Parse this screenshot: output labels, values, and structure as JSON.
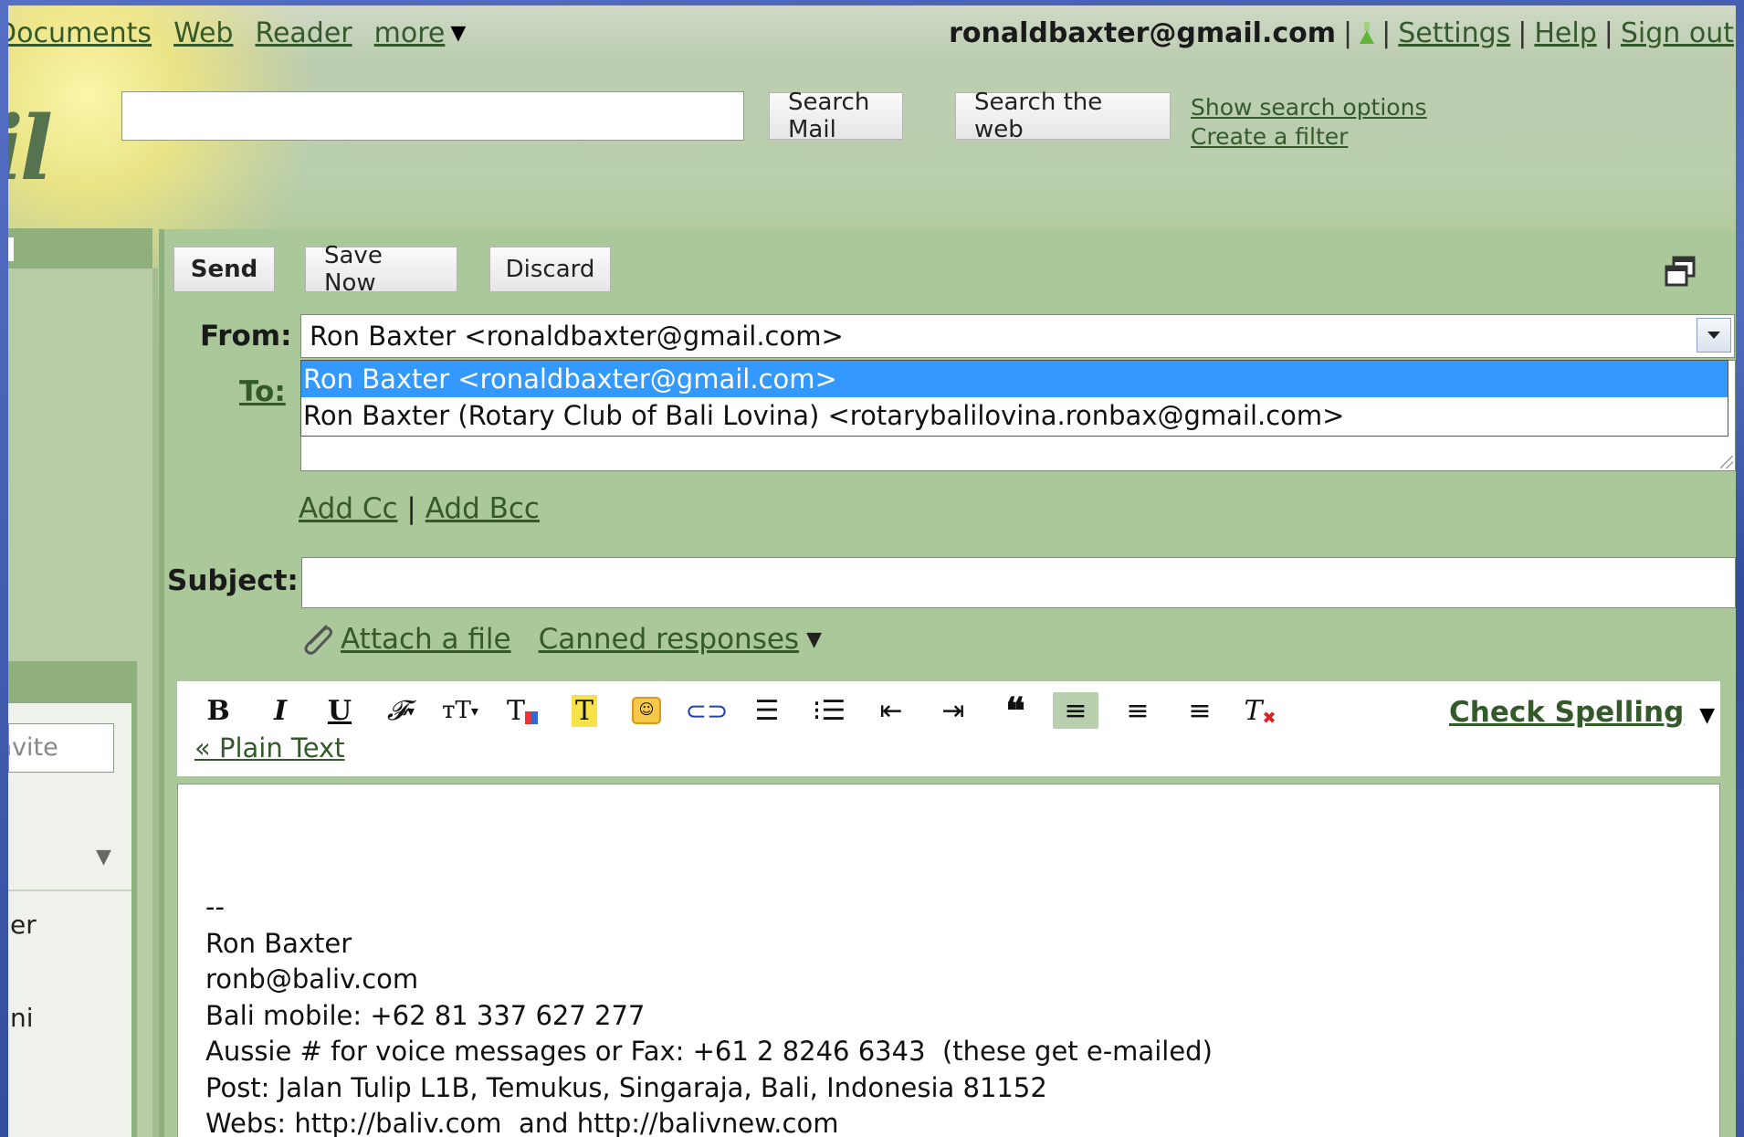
{
  "topnav": {
    "links": [
      "Documents",
      "Web",
      "Reader",
      "more"
    ],
    "more_arrow": "▼"
  },
  "usernav": {
    "email": "ronaldbaxter@gmail.com",
    "settings": "Settings",
    "help": "Help",
    "signout": "Sign out"
  },
  "logo_text": "ail",
  "search": {
    "query": "",
    "search_mail_label": "Search Mail",
    "search_web_label": "Search the web",
    "show_options": "Show search options",
    "create_filter": "Create a filter"
  },
  "sidebar": {
    "invite_placeholder": "Invite",
    "items": [
      "er",
      "ni"
    ]
  },
  "compose": {
    "send_label": "Send",
    "save_label": "Save Now",
    "discard_label": "Discard",
    "from_label": "From:",
    "to_label": "To:",
    "subject_label": "Subject:",
    "from_selected": "Ron Baxter <ronaldbaxter@gmail.com>",
    "from_options": [
      "Ron Baxter <ronaldbaxter@gmail.com>",
      "Ron Baxter (Rotary Club of Bali Lovina) <rotarybalilovina.ronbax@gmail.com>"
    ],
    "add_cc": "Add Cc",
    "add_bcc": "Add Bcc",
    "attach_file": "Attach a file",
    "canned_responses": "Canned responses",
    "check_spelling": "Check Spelling",
    "plain_text": "« Plain Text",
    "subject_value": ""
  },
  "toolbar_icons": [
    "bold-icon",
    "italic-icon",
    "underline-icon",
    "font-icon",
    "font-size-icon",
    "text-color-icon",
    "highlight-icon",
    "emoticon-icon",
    "link-icon",
    "numbered-list-icon",
    "bulleted-list-icon",
    "outdent-icon",
    "indent-icon",
    "quote-icon",
    "align-left-icon",
    "align-center-icon",
    "align-right-icon",
    "remove-formatting-icon"
  ],
  "signature": {
    "dashes": "--",
    "lines": [
      "Ron Baxter",
      "ronb@baliv.com",
      "Bali mobile: +62 81 337 627 277",
      "Aussie # for voice messages or Fax: +61 2 8246 6343  (these get e-mailed)",
      "Post: Jalan Tulip L1B, Temukus, Singaraja, Bali, Indonesia 81152",
      "Webs: http://baliv.com  and http://balivnew.com"
    ]
  },
  "colors": {
    "link": "#345a2c",
    "theme_green": "#abc89a",
    "selection_blue": "#3399ff"
  }
}
